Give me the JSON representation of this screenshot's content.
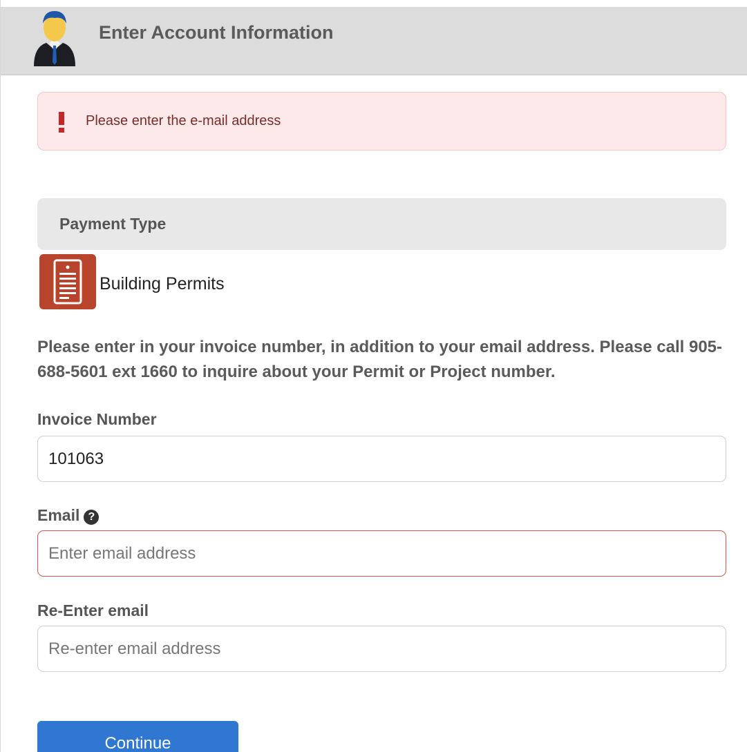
{
  "header": {
    "title": "Enter Account Information",
    "avatar_icon": "user-avatar-icon"
  },
  "alert": {
    "icon": "exclamation-icon",
    "message": "Please enter the e-mail address"
  },
  "payment_type": {
    "heading": "Payment Type",
    "icon": "document-icon",
    "selected_label": "Building Permits"
  },
  "instructions": "Please enter in your invoice number, in addition to your email address. Please call 905-688-5601 ext 1660 to inquire about your Permit or Project number.",
  "fields": {
    "invoice": {
      "label": "Invoice Number",
      "value": "101063"
    },
    "email": {
      "label": "Email",
      "help_icon": "question-circle-icon",
      "placeholder": "Enter email address",
      "value": ""
    },
    "reenter_email": {
      "label": "Re-Enter email",
      "placeholder": "Re-enter email address",
      "value": ""
    }
  },
  "actions": {
    "continue_label": "Continue"
  },
  "colors": {
    "header_bg": "#dcdcdc",
    "alert_bg": "#fde9e9",
    "alert_text": "#7a2b2b",
    "error_border": "#d9534f",
    "primary_button": "#2f77d0",
    "payment_icon_bg": "#b8452b"
  }
}
